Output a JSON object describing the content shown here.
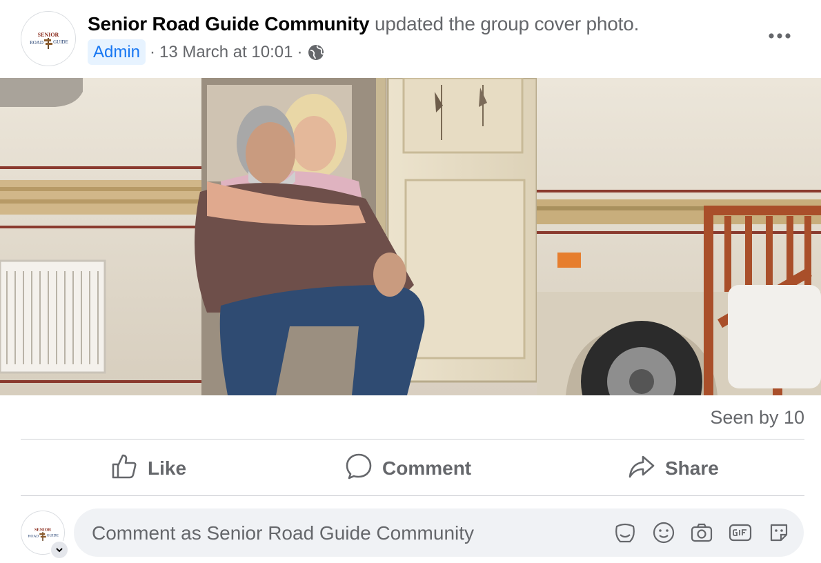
{
  "post": {
    "author": "Senior Road Guide Community",
    "action": "updated the group cover photo.",
    "badge": "Admin",
    "timestamp": "13 March at 10:01",
    "separator": "·",
    "privacy_icon": "globe-icon",
    "avatar_text_top": "SENIOR",
    "avatar_text_left": "ROAD",
    "avatar_text_right": "GUIDE",
    "more_icon": "more-options-icon"
  },
  "photo": {
    "subject": "cover-photo"
  },
  "stats": {
    "seen": "Seen by 10"
  },
  "actions": {
    "like": "Like",
    "comment": "Comment",
    "share": "Share"
  },
  "composer": {
    "placeholder": "Comment as Senior Road Guide Community",
    "icons": [
      "avatar-sticker-icon",
      "emoji-icon",
      "camera-icon",
      "gif-icon",
      "sticker-icon"
    ]
  },
  "colors": {
    "accent": "#1877f2",
    "badge_bg": "#e7f3ff",
    "secondary_text": "#65676b",
    "input_bg": "#f0f2f5"
  }
}
